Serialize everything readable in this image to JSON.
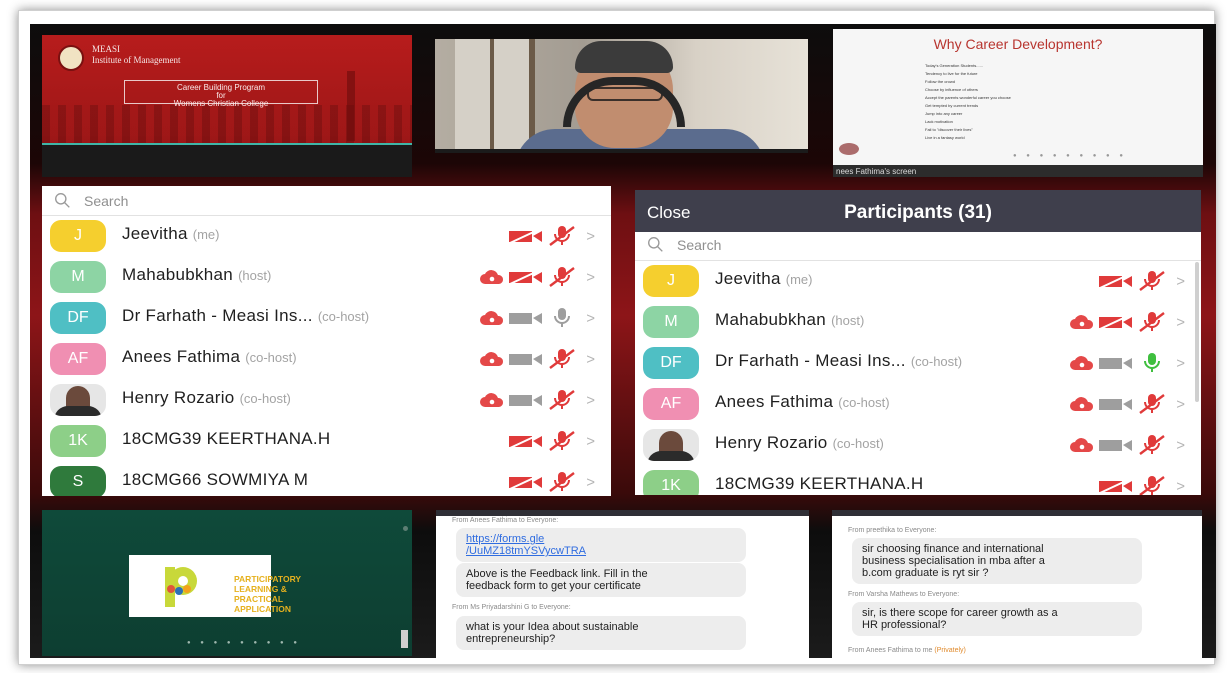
{
  "slide1": {
    "brand_line1": "MEASI",
    "brand_line2": "Institute of Management",
    "title_line1": "Career Building Program",
    "title_line2": "for",
    "title_line3": "Womens Christian College"
  },
  "slide2": {
    "title": "Why Career Development?",
    "lines": [
      "Today's Generation Students......",
      "Tendency to live for the future",
      "Follow the crowd",
      "Choose by influence of others",
      "Accept the parents wonderful career you choose",
      "Get tempted by current trends",
      "Jump into any career",
      "Lack motivation",
      "Fail to \"discover their lives\"",
      "Live in a fantasy world"
    ],
    "footer": "nees Fathima's screen"
  },
  "list_left": {
    "search_placeholder": "Search",
    "participants": [
      {
        "initials": "J",
        "name": "Jeevitha",
        "role": "(me)",
        "color": "#f5cf2e"
      },
      {
        "initials": "M",
        "name": "Mahabubkhan",
        "role": "(host)",
        "color": "#8dd4a4"
      },
      {
        "initials": "DF",
        "name": "Dr Farhath - Measi Ins...",
        "role": "(co-host)",
        "color": "#4fbfc4"
      },
      {
        "initials": "AF",
        "name": "Anees Fathima",
        "role": "(co-host)",
        "color": "#f08fb2"
      },
      {
        "initials": "",
        "name": "Henry Rozario",
        "role": "(co-host)",
        "color": ""
      },
      {
        "initials": "1K",
        "name": "18CMG39 KEERTHANA.H",
        "role": "",
        "color": "#8dcf88"
      },
      {
        "initials": "S",
        "name": "18CMG66 SOWMIYA M",
        "role": "",
        "color": "#2f7a3c"
      }
    ]
  },
  "list_right": {
    "close_label": "Close",
    "title": "Participants (31)",
    "search_placeholder": "Search",
    "participants": [
      {
        "initials": "J",
        "name": "Jeevitha",
        "role": "(me)",
        "color": "#f5cf2e"
      },
      {
        "initials": "M",
        "name": "Mahabubkhan",
        "role": "(host)",
        "color": "#8dd4a4"
      },
      {
        "initials": "DF",
        "name": "Dr Farhath - Measi Ins...",
        "role": "(co-host)",
        "color": "#4fbfc4"
      },
      {
        "initials": "AF",
        "name": "Anees Fathima",
        "role": "(co-host)",
        "color": "#f08fb2"
      },
      {
        "initials": "",
        "name": "Henry Rozario",
        "role": "(co-host)",
        "color": ""
      },
      {
        "initials": "1K",
        "name": "18CMG39 KEERTHANA.H",
        "role": "",
        "color": "#8dcf88"
      }
    ]
  },
  "slide3": {
    "text_line1": "PARTICIPATORY",
    "text_line2": "LEARNING &",
    "text_line3": "PRACTICAL",
    "text_line4": "APPLICATION"
  },
  "chat_left": {
    "sender1": "From Anees Fathima to Everyone:",
    "link_line1": "https://forms.gle",
    "link_line2": "/UuMZ18tmYSVycwTRA",
    "msg2_line1": "Above is the Feedback link. Fill in the",
    "msg2_line2": "feedback form to get your certificate",
    "sender3": "From Ms Priyadarshini G to Everyone:",
    "msg3_line1": "what is your Idea about sustainable",
    "msg3_line2": "entrepreneurship?"
  },
  "chat_right": {
    "sender1": "From preethika to Everyone:",
    "msg1_line1": "sir choosing finance and international",
    "msg1_line2": "business specialisation in mba after a",
    "msg1_line3": "b.com graduate is ryt sir ?",
    "sender2": "From Varsha Mathews to Everyone:",
    "msg2_line1": "sir, is there scope for career growth as a",
    "msg2_line2": "HR professional?",
    "sender3": "From Anees Fathima to me",
    "sender3_private": "(Privately)"
  },
  "colors": {
    "muted_red": "#e03a3a",
    "cloud_red": "#e44848",
    "cam_gray": "#9e9e9e",
    "mic_green": "#3fbf3f",
    "header_dark": "#3f3f4c"
  }
}
